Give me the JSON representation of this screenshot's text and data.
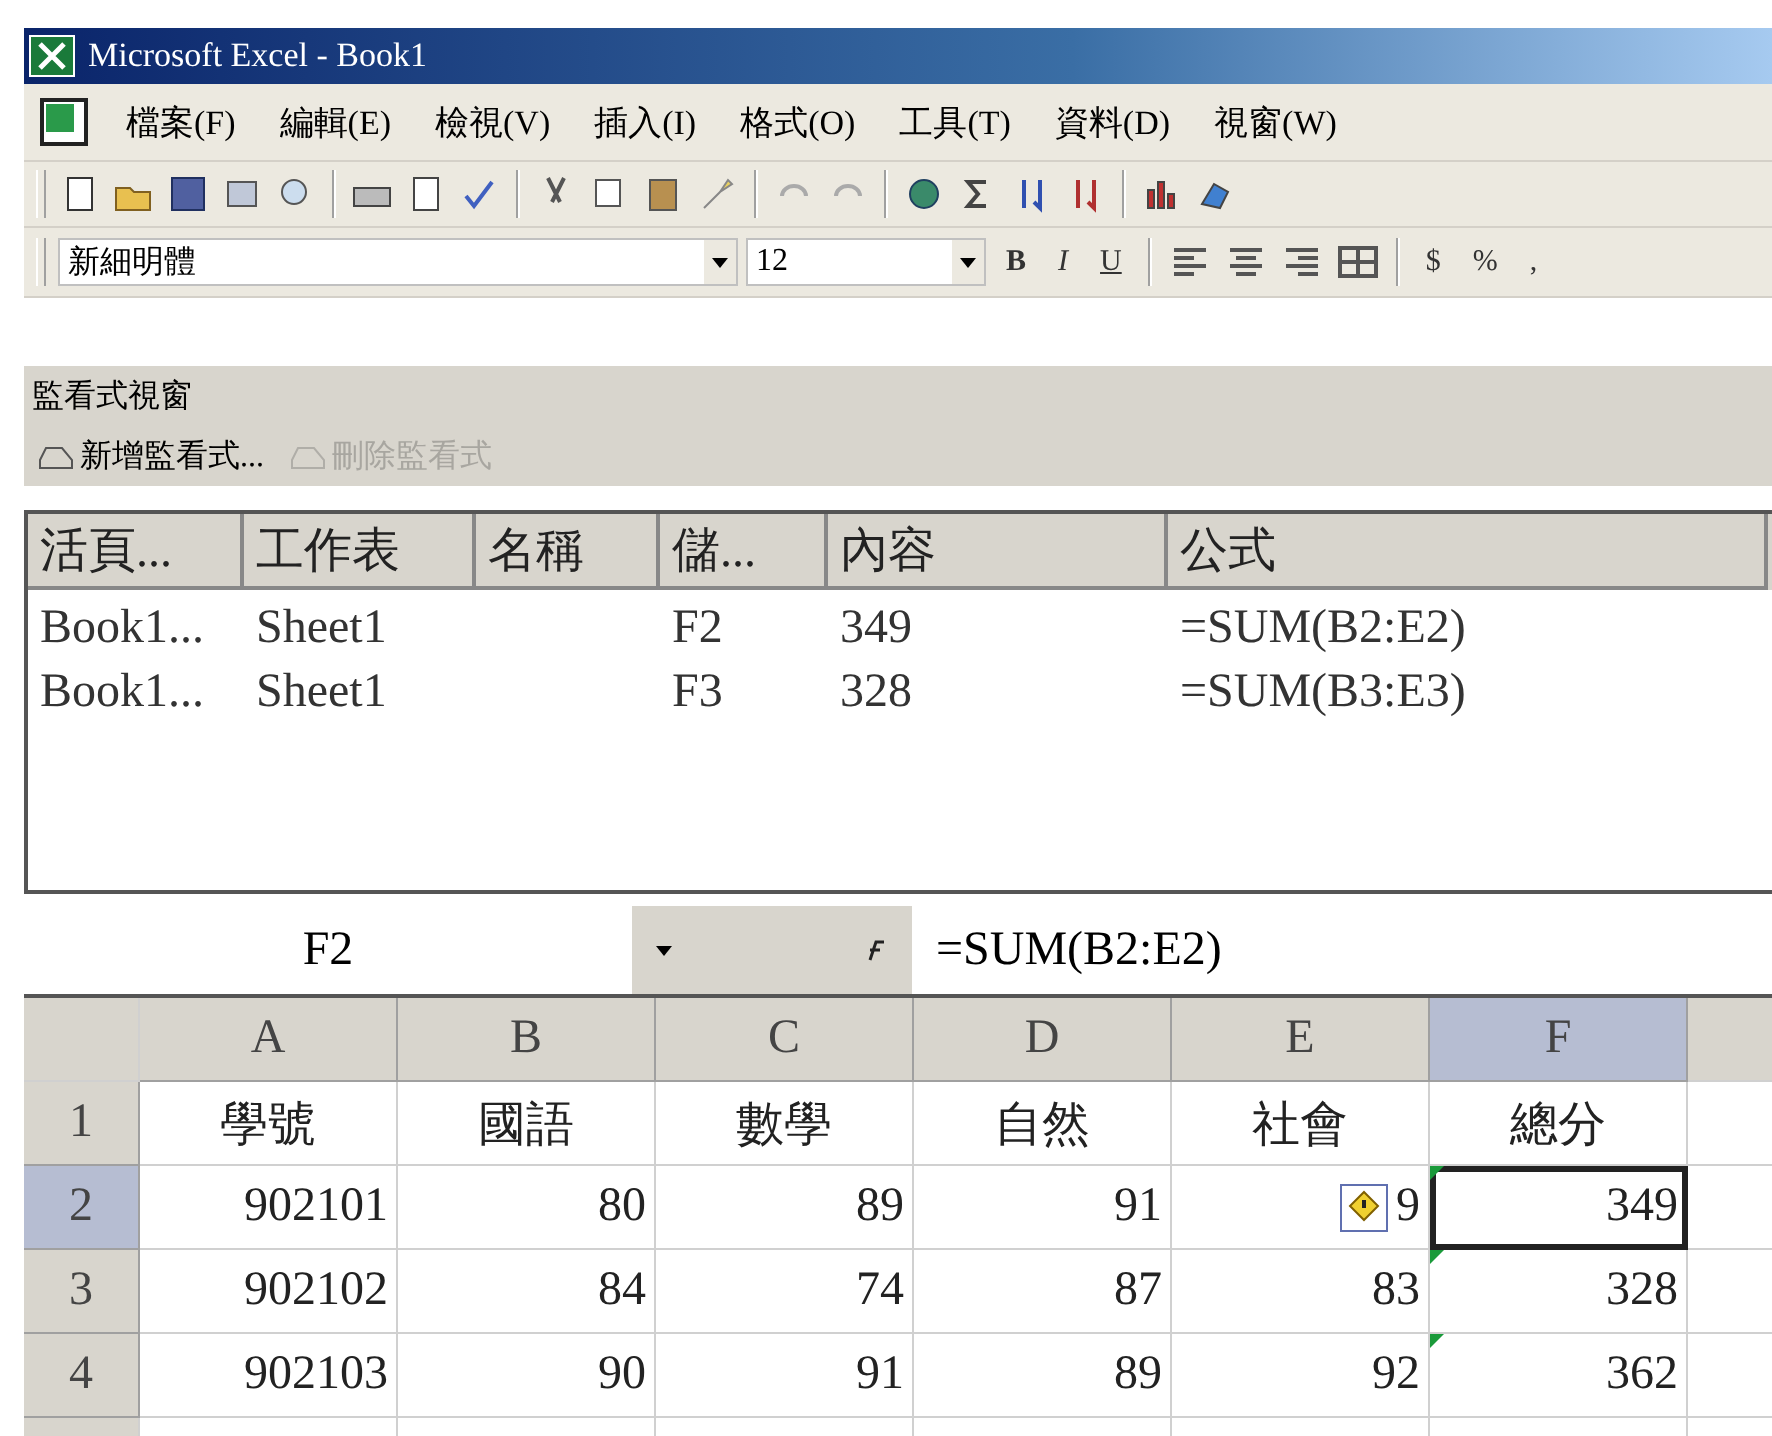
{
  "window": {
    "title": "Microsoft Excel - Book1"
  },
  "menu": [
    "檔案(F)",
    "編輯(E)",
    "檢視(V)",
    "插入(I)",
    "格式(O)",
    "工具(T)",
    "資料(D)",
    "視窗(W)"
  ],
  "format_bar": {
    "font": "新細明體",
    "size": "12",
    "style_buttons": [
      "B",
      "I",
      "U"
    ],
    "number_buttons": [
      "$",
      "%",
      ","
    ]
  },
  "watch_window": {
    "title": "監看式視窗",
    "actions": [
      {
        "label": "新增監看式...",
        "disabled": false
      },
      {
        "label": "刪除監看式",
        "disabled": true
      }
    ],
    "columns": [
      "活頁...",
      "工作表",
      "名稱",
      "儲...",
      "內容",
      "公式"
    ],
    "rows": [
      [
        "Book1...",
        "Sheet1",
        "",
        "F2",
        "349",
        "=SUM(B2:E2)"
      ],
      [
        "Book1...",
        "Sheet1",
        "",
        "F3",
        "328",
        "=SUM(B3:E3)"
      ]
    ]
  },
  "formula_bar": {
    "name_box": "F2",
    "formula": "=SUM(B2:E2)"
  },
  "sheet": {
    "columns": [
      {
        "label": "A",
        "selected": false
      },
      {
        "label": "B",
        "selected": false
      },
      {
        "label": "C",
        "selected": false
      },
      {
        "label": "D",
        "selected": false
      },
      {
        "label": "E",
        "selected": false
      },
      {
        "label": "F",
        "selected": true
      }
    ],
    "rows": [
      {
        "label": "1",
        "selected": false,
        "cells": [
          {
            "text": "學號",
            "kind": "text"
          },
          {
            "text": "國語",
            "kind": "text"
          },
          {
            "text": "數學",
            "kind": "text"
          },
          {
            "text": "自然",
            "kind": "text"
          },
          {
            "text": "社會",
            "kind": "text"
          },
          {
            "text": "總分",
            "kind": "text"
          }
        ]
      },
      {
        "label": "2",
        "selected": true,
        "cells": [
          {
            "text": "902101",
            "kind": "number"
          },
          {
            "text": "80",
            "kind": "number"
          },
          {
            "text": "89",
            "kind": "number"
          },
          {
            "text": "91",
            "kind": "number"
          },
          {
            "text": "9",
            "kind": "number",
            "smart_tag": true
          },
          {
            "text": "349",
            "kind": "number",
            "flagged": true,
            "active": true
          }
        ]
      },
      {
        "label": "3",
        "selected": false,
        "cells": [
          {
            "text": "902102",
            "kind": "number"
          },
          {
            "text": "84",
            "kind": "number"
          },
          {
            "text": "74",
            "kind": "number"
          },
          {
            "text": "87",
            "kind": "number"
          },
          {
            "text": "83",
            "kind": "number"
          },
          {
            "text": "328",
            "kind": "number",
            "flagged": true
          }
        ]
      },
      {
        "label": "4",
        "selected": false,
        "cells": [
          {
            "text": "902103",
            "kind": "number"
          },
          {
            "text": "90",
            "kind": "number"
          },
          {
            "text": "91",
            "kind": "number"
          },
          {
            "text": "89",
            "kind": "number"
          },
          {
            "text": "92",
            "kind": "number"
          },
          {
            "text": "362",
            "kind": "number",
            "flagged": true
          }
        ]
      }
    ]
  }
}
